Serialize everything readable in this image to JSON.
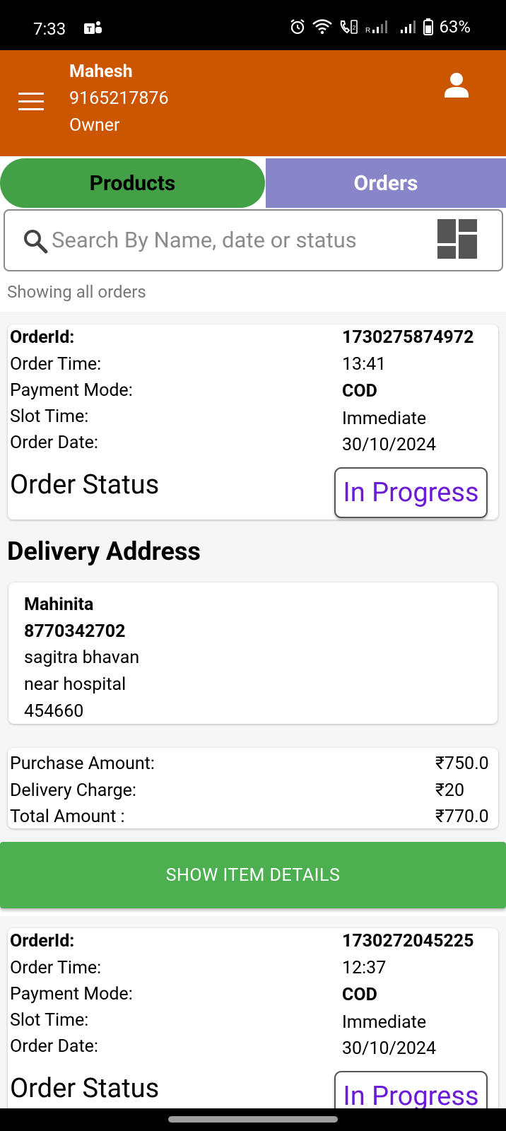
{
  "status_bar": {
    "time": "7:33",
    "battery": "63%",
    "icons": [
      "teams-icon",
      "alarm-icon",
      "wifi-icon",
      "volte-call-icon",
      "signal-icon",
      "signal-icon",
      "battery-icon"
    ]
  },
  "header": {
    "name": "Mahesh",
    "phone": "9165217876",
    "role": "Owner",
    "bg_color": "#cc5500"
  },
  "tabs": {
    "products": "Products",
    "orders": "Orders",
    "products_color": "#43a047",
    "orders_color": "#8885c9"
  },
  "search": {
    "placeholder": "Search By Name, date or status"
  },
  "showing_text": "Showing all orders",
  "orders": [
    {
      "labels": {
        "order_id": "OrderId:",
        "order_time": "Order Time:",
        "payment_mode": "Payment Mode:",
        "slot_time": "Slot Time:",
        "order_date": "Order Date:",
        "order_status": "Order Status"
      },
      "order_id": "1730275874972",
      "order_time": "13:41",
      "payment_mode": "COD",
      "slot_time": "Immediate",
      "order_date": "30/10/2024",
      "status": "In Progress",
      "delivery_heading": "Delivery Address",
      "address": {
        "name": "Mahinita",
        "phone": "8770342702",
        "line1": "sagitra bhavan",
        "line2": "near hospital",
        "pincode": "454660"
      },
      "amounts": {
        "purchase_label": "Purchase Amount:",
        "purchase_value": "₹750.0",
        "delivery_label": "Delivery Charge:",
        "delivery_value": "₹20",
        "total_label": "Total Amount :",
        "total_value": "₹770.0"
      },
      "show_items_label": "SHOW ITEM DETAILS"
    },
    {
      "labels": {
        "order_id": "OrderId:",
        "order_time": "Order Time:",
        "payment_mode": "Payment Mode:",
        "slot_time": "Slot Time:",
        "order_date": "Order Date:",
        "order_status": "Order Status"
      },
      "order_id": "1730272045225",
      "order_time": "12:37",
      "payment_mode": "COD",
      "slot_time": "Immediate",
      "order_date": "30/10/2024",
      "status": "In Progress"
    }
  ]
}
